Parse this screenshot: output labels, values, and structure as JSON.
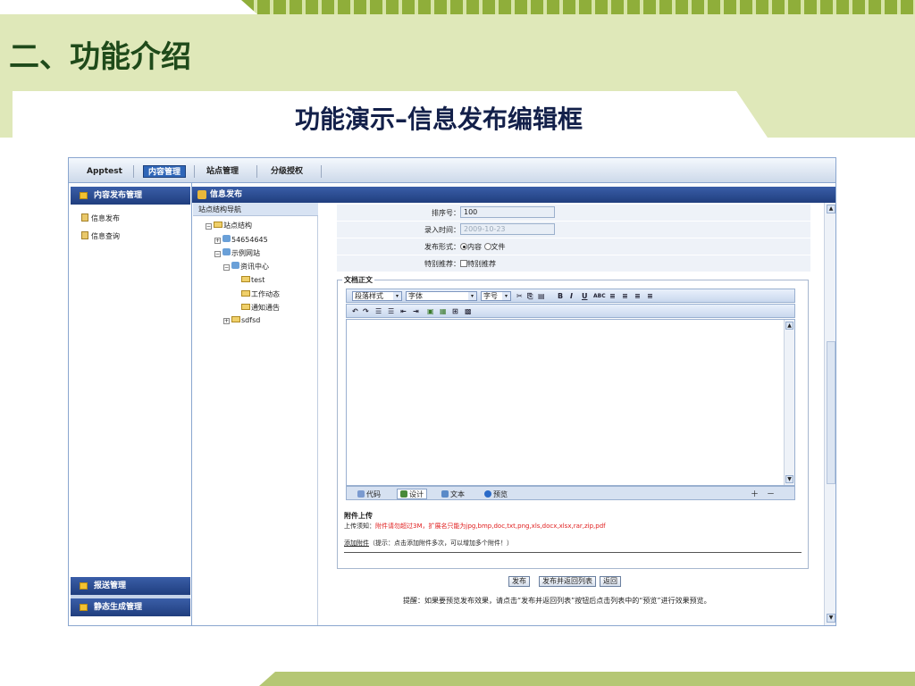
{
  "slide": {
    "title": "二、功能介绍",
    "subtitle": "功能演示–信息发布编辑框"
  },
  "topnav": {
    "tabs": [
      "Apptest",
      "内容管理",
      "站点管理",
      "分级授权"
    ],
    "active_tab": "内容管理"
  },
  "left_panel": {
    "header": "内容发布管理",
    "items": [
      "信息发布",
      "信息查询"
    ],
    "footer_panels": [
      "报送管理",
      "静态生成管理"
    ]
  },
  "main": {
    "header": "信息发布",
    "tree": {
      "title": "站点结构导航",
      "nodes": [
        "站点结构",
        "54654645",
        "示例网站",
        "资讯中心",
        "test",
        "工作动态",
        "通知通告",
        "sdfsd"
      ]
    },
    "form": {
      "sort_label": "排序号：",
      "sort_value": "100",
      "date_label": "录入时间：",
      "date_value": "2009-10-23",
      "publish_form_label": "发布形式：",
      "publish_options": [
        "内容",
        "文件"
      ],
      "publish_selected": "内容",
      "special_label": "特别推荐：",
      "special_option": "特别推荐",
      "body_legend": "文档正文"
    },
    "editor": {
      "paragraph_style": "段落样式",
      "font": "字体",
      "font_size": "字号",
      "modes": [
        "代码",
        "设计",
        "文本",
        "预览"
      ],
      "active_mode": "设计"
    },
    "attachment": {
      "title": "附件上传",
      "note_label": "上传须知：",
      "note_text": "附件请勿超过3M，扩展名只能为jpg,bmp,doc,txt,png,xls,docx,xlsx,rar,zip,pdf",
      "add_label": "添加附件",
      "add_hint": "（提示：点击添加附件多次，可以增加多个附件！）"
    },
    "buttons": [
      "发布",
      "发布并返回列表",
      "返回"
    ],
    "tip": "提醒：如果要预览发布效果，请点击“发布并返回列表”按钮后点击列表中的“预览”进行效果预览。"
  },
  "colors": {
    "slide_green": "#dfe8b9",
    "stripe_green": "#8fae3a",
    "header_blue": "#2a4a8e",
    "accent_blue": "#2f66b8",
    "warning_red": "#e02020"
  }
}
